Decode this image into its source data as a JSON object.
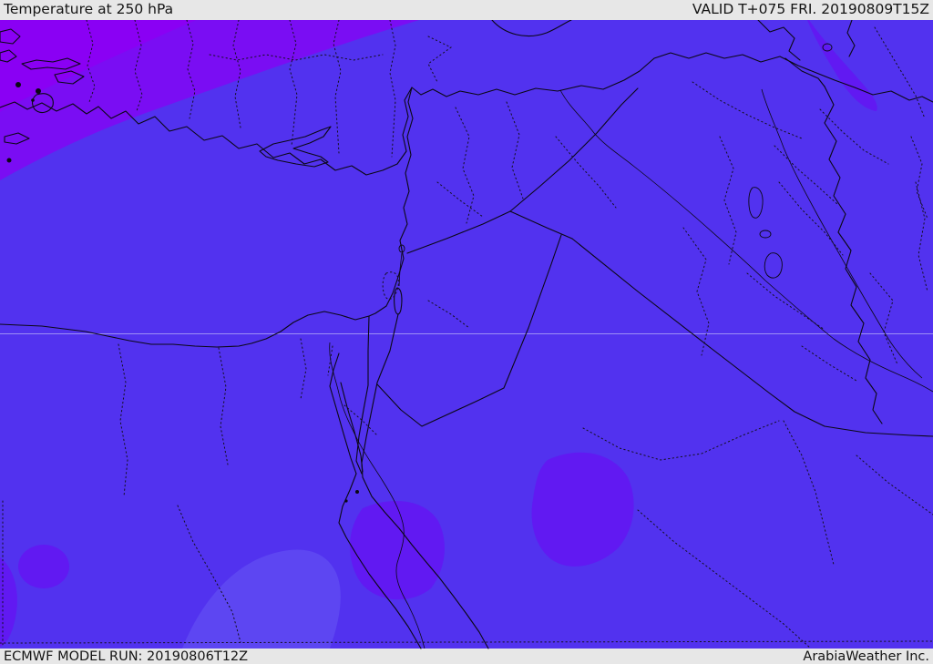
{
  "header": {
    "title": "Temperature at 250 hPa",
    "valid_label": "VALID T+075 FRI. 20190809T15Z"
  },
  "footer": {
    "model_run": "ECMWF MODEL RUN: 20190806T12Z",
    "credit": "ArabiaWeather Inc."
  },
  "map": {
    "colors": {
      "band_warmest": "#8a00f4",
      "band_warm": "#7a0df3",
      "band_mid": "#6119f2",
      "band_base": "#5232ef",
      "band_cool": "#5d46f2",
      "gridline": "rgba(220,220,250,0.55)"
    }
  }
}
